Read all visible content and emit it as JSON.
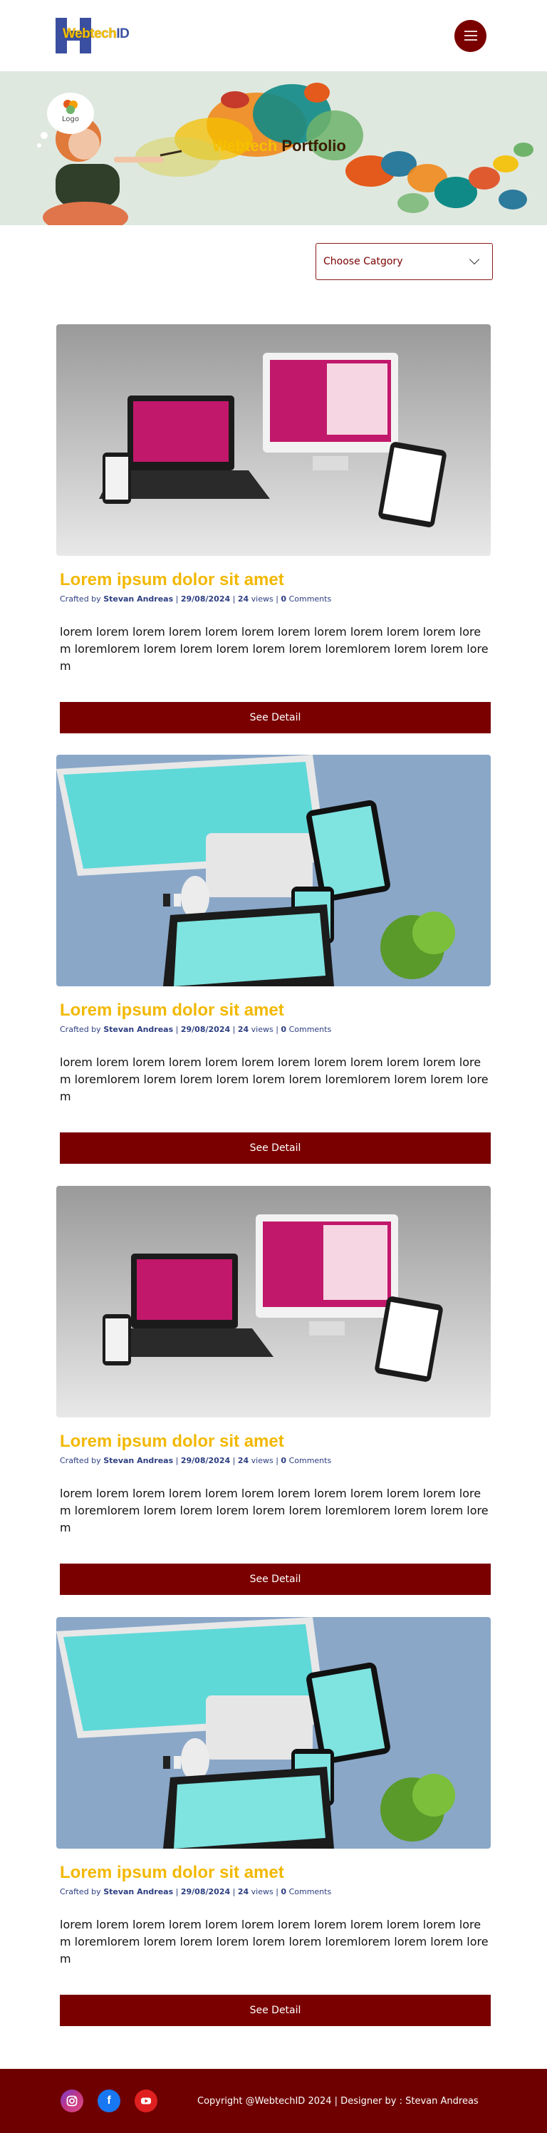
{
  "header": {
    "logo_part1": "Webtech",
    "logo_part2": "ID"
  },
  "hero": {
    "bubble_label": "Logo",
    "title_part1": "Webtech",
    "title_part2": "Portfolio"
  },
  "filter": {
    "selected": "Choose Catgory"
  },
  "cards": [
    {
      "title": "Lorem ipsum dolor sit amet",
      "meta_prefix": "Crafted by",
      "author": "Stevan Andreas",
      "date": "29/08/2024",
      "views_count": "24",
      "views_label": "views",
      "comments_count": "0",
      "comments_label": "Comments",
      "excerpt": "lorem lorem lorem lorem lorem lorem lorem lorem lorem lorem lorem lorem loremlorem lorem lorem lorem lorem lorem loremlorem lorem lorem lorem",
      "button": "See Detail"
    },
    {
      "title": "Lorem ipsum dolor sit amet",
      "meta_prefix": "Crafted by",
      "author": "Stevan Andreas",
      "date": "29/08/2024",
      "views_count": "24",
      "views_label": "views",
      "comments_count": "0",
      "comments_label": "Comments",
      "excerpt": "lorem lorem lorem lorem lorem lorem lorem lorem lorem lorem lorem lorem loremlorem lorem lorem lorem lorem lorem loremlorem lorem lorem lorem",
      "button": "See Detail"
    },
    {
      "title": "Lorem ipsum dolor sit amet",
      "meta_prefix": "Crafted by",
      "author": "Stevan Andreas",
      "date": "29/08/2024",
      "views_count": "24",
      "views_label": "views",
      "comments_count": "0",
      "comments_label": "Comments",
      "excerpt": "lorem lorem lorem lorem lorem lorem lorem lorem lorem lorem lorem lorem loremlorem lorem lorem lorem lorem lorem loremlorem lorem lorem lorem",
      "button": "See Detail"
    },
    {
      "title": "Lorem ipsum dolor sit amet",
      "meta_prefix": "Crafted by",
      "author": "Stevan Andreas",
      "date": "29/08/2024",
      "views_count": "24",
      "views_label": "views",
      "comments_count": "0",
      "comments_label": "Comments",
      "excerpt": "lorem lorem lorem lorem lorem lorem lorem lorem lorem lorem lorem lorem loremlorem lorem lorem lorem lorem lorem loremlorem lorem lorem lorem",
      "button": "See Detail"
    }
  ],
  "footer": {
    "social": [
      "instagram-icon",
      "facebook-icon",
      "youtube-icon"
    ],
    "copyright": "Copyright @WebtechID 2024 | Designer by : Stevan Andreas"
  },
  "colors": {
    "brand_red": "#7a0000",
    "brand_yellow": "#f2b800",
    "brand_blue": "#3a4fa0"
  }
}
